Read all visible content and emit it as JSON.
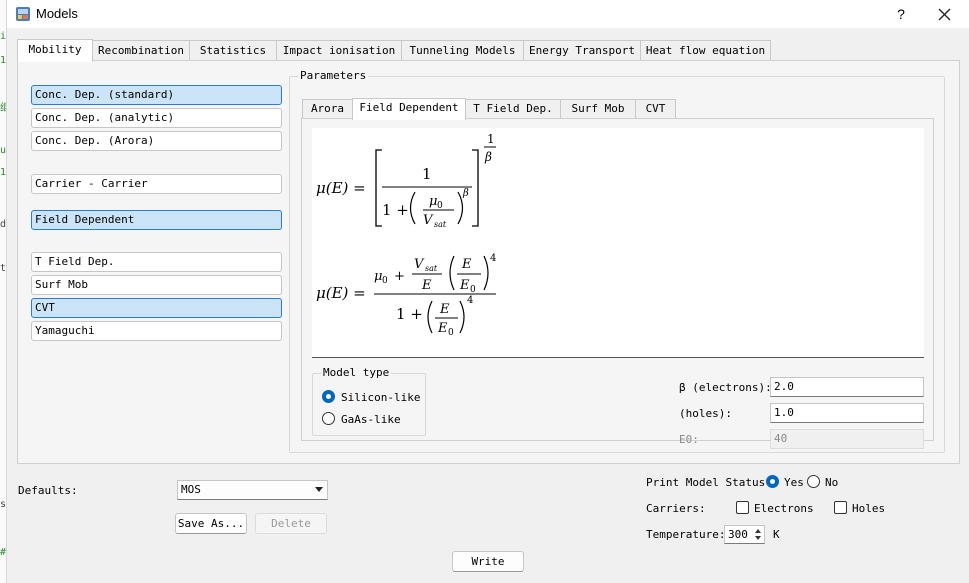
{
  "window": {
    "title": "Models",
    "help_label": "?"
  },
  "edge_glyphs": [
    "i",
    "1",
    "继",
    "u",
    "1",
    "d",
    "t",
    "s",
    "#"
  ],
  "tabs": [
    {
      "label": "Mobility",
      "active": true
    },
    {
      "label": "Recombination"
    },
    {
      "label": "Statistics"
    },
    {
      "label": "Impact ionisation"
    },
    {
      "label": "Tunneling Models"
    },
    {
      "label": "Energy Transport"
    },
    {
      "label": "Heat flow equation"
    }
  ],
  "models_list": [
    {
      "label": "Conc. Dep. (standard)",
      "selected": true
    },
    {
      "label": "Conc. Dep. (analytic)",
      "selected": false
    },
    {
      "label": "Conc. Dep. (Arora)",
      "selected": false
    },
    {
      "label": "Carrier - Carrier",
      "selected": false
    },
    {
      "label": "Field Dependent",
      "selected": true
    },
    {
      "label": "T Field Dep.",
      "selected": false
    },
    {
      "label": "Surf Mob",
      "selected": false
    },
    {
      "label": "CVT",
      "selected": true
    },
    {
      "label": "Yamaguchi",
      "selected": false
    }
  ],
  "parameters": {
    "title": "Parameters",
    "subtabs": [
      {
        "label": "Arora"
      },
      {
        "label": "Field Dependent",
        "active": true
      },
      {
        "label": "T Field Dep."
      },
      {
        "label": "Surf Mob"
      },
      {
        "label": "CVT"
      }
    ],
    "formula": {
      "lhs": "μ(E) =",
      "one": "1",
      "mu0": "μ",
      "sub0": "0",
      "vsat": "V",
      "sat": "sat",
      "beta": "β",
      "E": "E",
      "E0": "E",
      "four": "4",
      "plus": "1 +",
      "mu0_plus": "+"
    },
    "model_type": {
      "title": "Model type",
      "options": [
        {
          "label": "Silicon-like",
          "checked": true
        },
        {
          "label": "GaAs-like",
          "checked": false
        }
      ]
    },
    "beta_electrons": {
      "label": "β (electrons):",
      "value": "2.0"
    },
    "beta_holes": {
      "label": "(holes):",
      "value": "1.0"
    },
    "e0": {
      "label": "E0:",
      "value": "40"
    }
  },
  "footer": {
    "defaults_label": "Defaults:",
    "defaults_value": "MOS",
    "save_as": "Save As...",
    "delete": "Delete",
    "write": "Write",
    "print_status_label": "Print Model Status:",
    "print_yes": "Yes",
    "print_no": "No",
    "print_status_value": "Yes",
    "carriers_label": "Carriers:",
    "electrons": "Electrons",
    "holes": "Holes",
    "temperature_label": "Temperature:",
    "temperature_value": "300",
    "temperature_unit": "K"
  },
  "colors": {
    "selected_bg": "#cce4f7",
    "selected_border": "#2b7cd3",
    "radio_accent": "#0067c0"
  }
}
